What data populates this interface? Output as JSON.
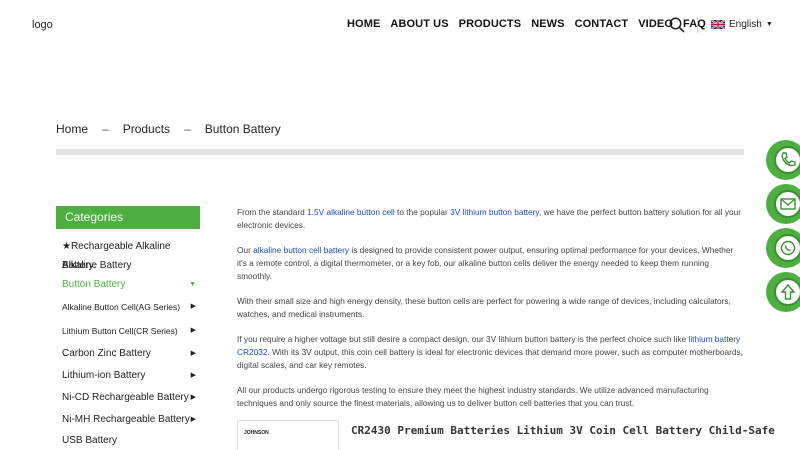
{
  "header": {
    "logo": "logo",
    "nav": [
      "HOME",
      "ABOUT US",
      "PRODUCTS",
      "NEWS",
      "CONTACT",
      "VIDEO",
      "FAQ"
    ],
    "language": "English"
  },
  "breadcrumb": {
    "items": [
      "Home",
      "Products",
      "Button Battery"
    ],
    "separator": "–"
  },
  "sidebar": {
    "title": "Categories",
    "items": [
      {
        "label": "★Rechargeable Alkaline Battery"
      },
      {
        "label": "Alkaline Battery"
      },
      {
        "label": "Button Battery"
      },
      {
        "label": "Alkaline Button Cell(AG Series)"
      },
      {
        "label": "Lithium Button Cell(CR Series)"
      },
      {
        "label": "Carbon Zinc Battery"
      },
      {
        "label": "Lithium-ion Battery"
      },
      {
        "label": "Ni-CD Rechargeable Battery"
      },
      {
        "label": "Ni-MH Rechargeable Battery"
      },
      {
        "label": "USB Battery"
      }
    ],
    "arrow": "▶",
    "arrow_open": "▼"
  },
  "content": {
    "p1": {
      "a": "From the standard ",
      "link1": "1.5V alkaline button cell",
      "b": " to the popular ",
      "link2": "3V lithium button battery",
      "c": ", we have the perfect button battery solution for all your electronic devices."
    },
    "p2": {
      "a": "Our ",
      "link1": "alkaline button cell battery",
      "b": " is designed to provide consistent power output, ensuring optimal performance for your devices. Whether it's a remote control, a digital thermometer, or a key fob, our alkaline button cells deliver the energy needed to keep them running smoothly."
    },
    "p3": "With their small size and high energy density, these button cells are perfect for powering a wide range of devices, including calculators, watches, and medical instruments.",
    "p4": {
      "a": "If you require a higher voltage but still desire a compact design, our 3V lithium button battery is the perfect choice such like ",
      "link1": "lithium battery CR2032",
      "b": ". With its 3V output, this coin cell battery is ideal for electronic devices that demand more power, such as computer motherboards, digital scales, and car key remotes."
    },
    "p5": "All our products undergo rigorous testing to ensure they meet the highest industry standards. We utilize advanced manufacturing techniques and only source the finest materials, allowing us to deliver button cell batteries that you can trust."
  },
  "product": {
    "brand": "JOHNSON",
    "title": "CR2430 Premium Batteries Lithium 3V Coin Cell Battery Child-Safe"
  },
  "colors": {
    "accent": "#4caf3f",
    "link": "#1e4bb8"
  }
}
